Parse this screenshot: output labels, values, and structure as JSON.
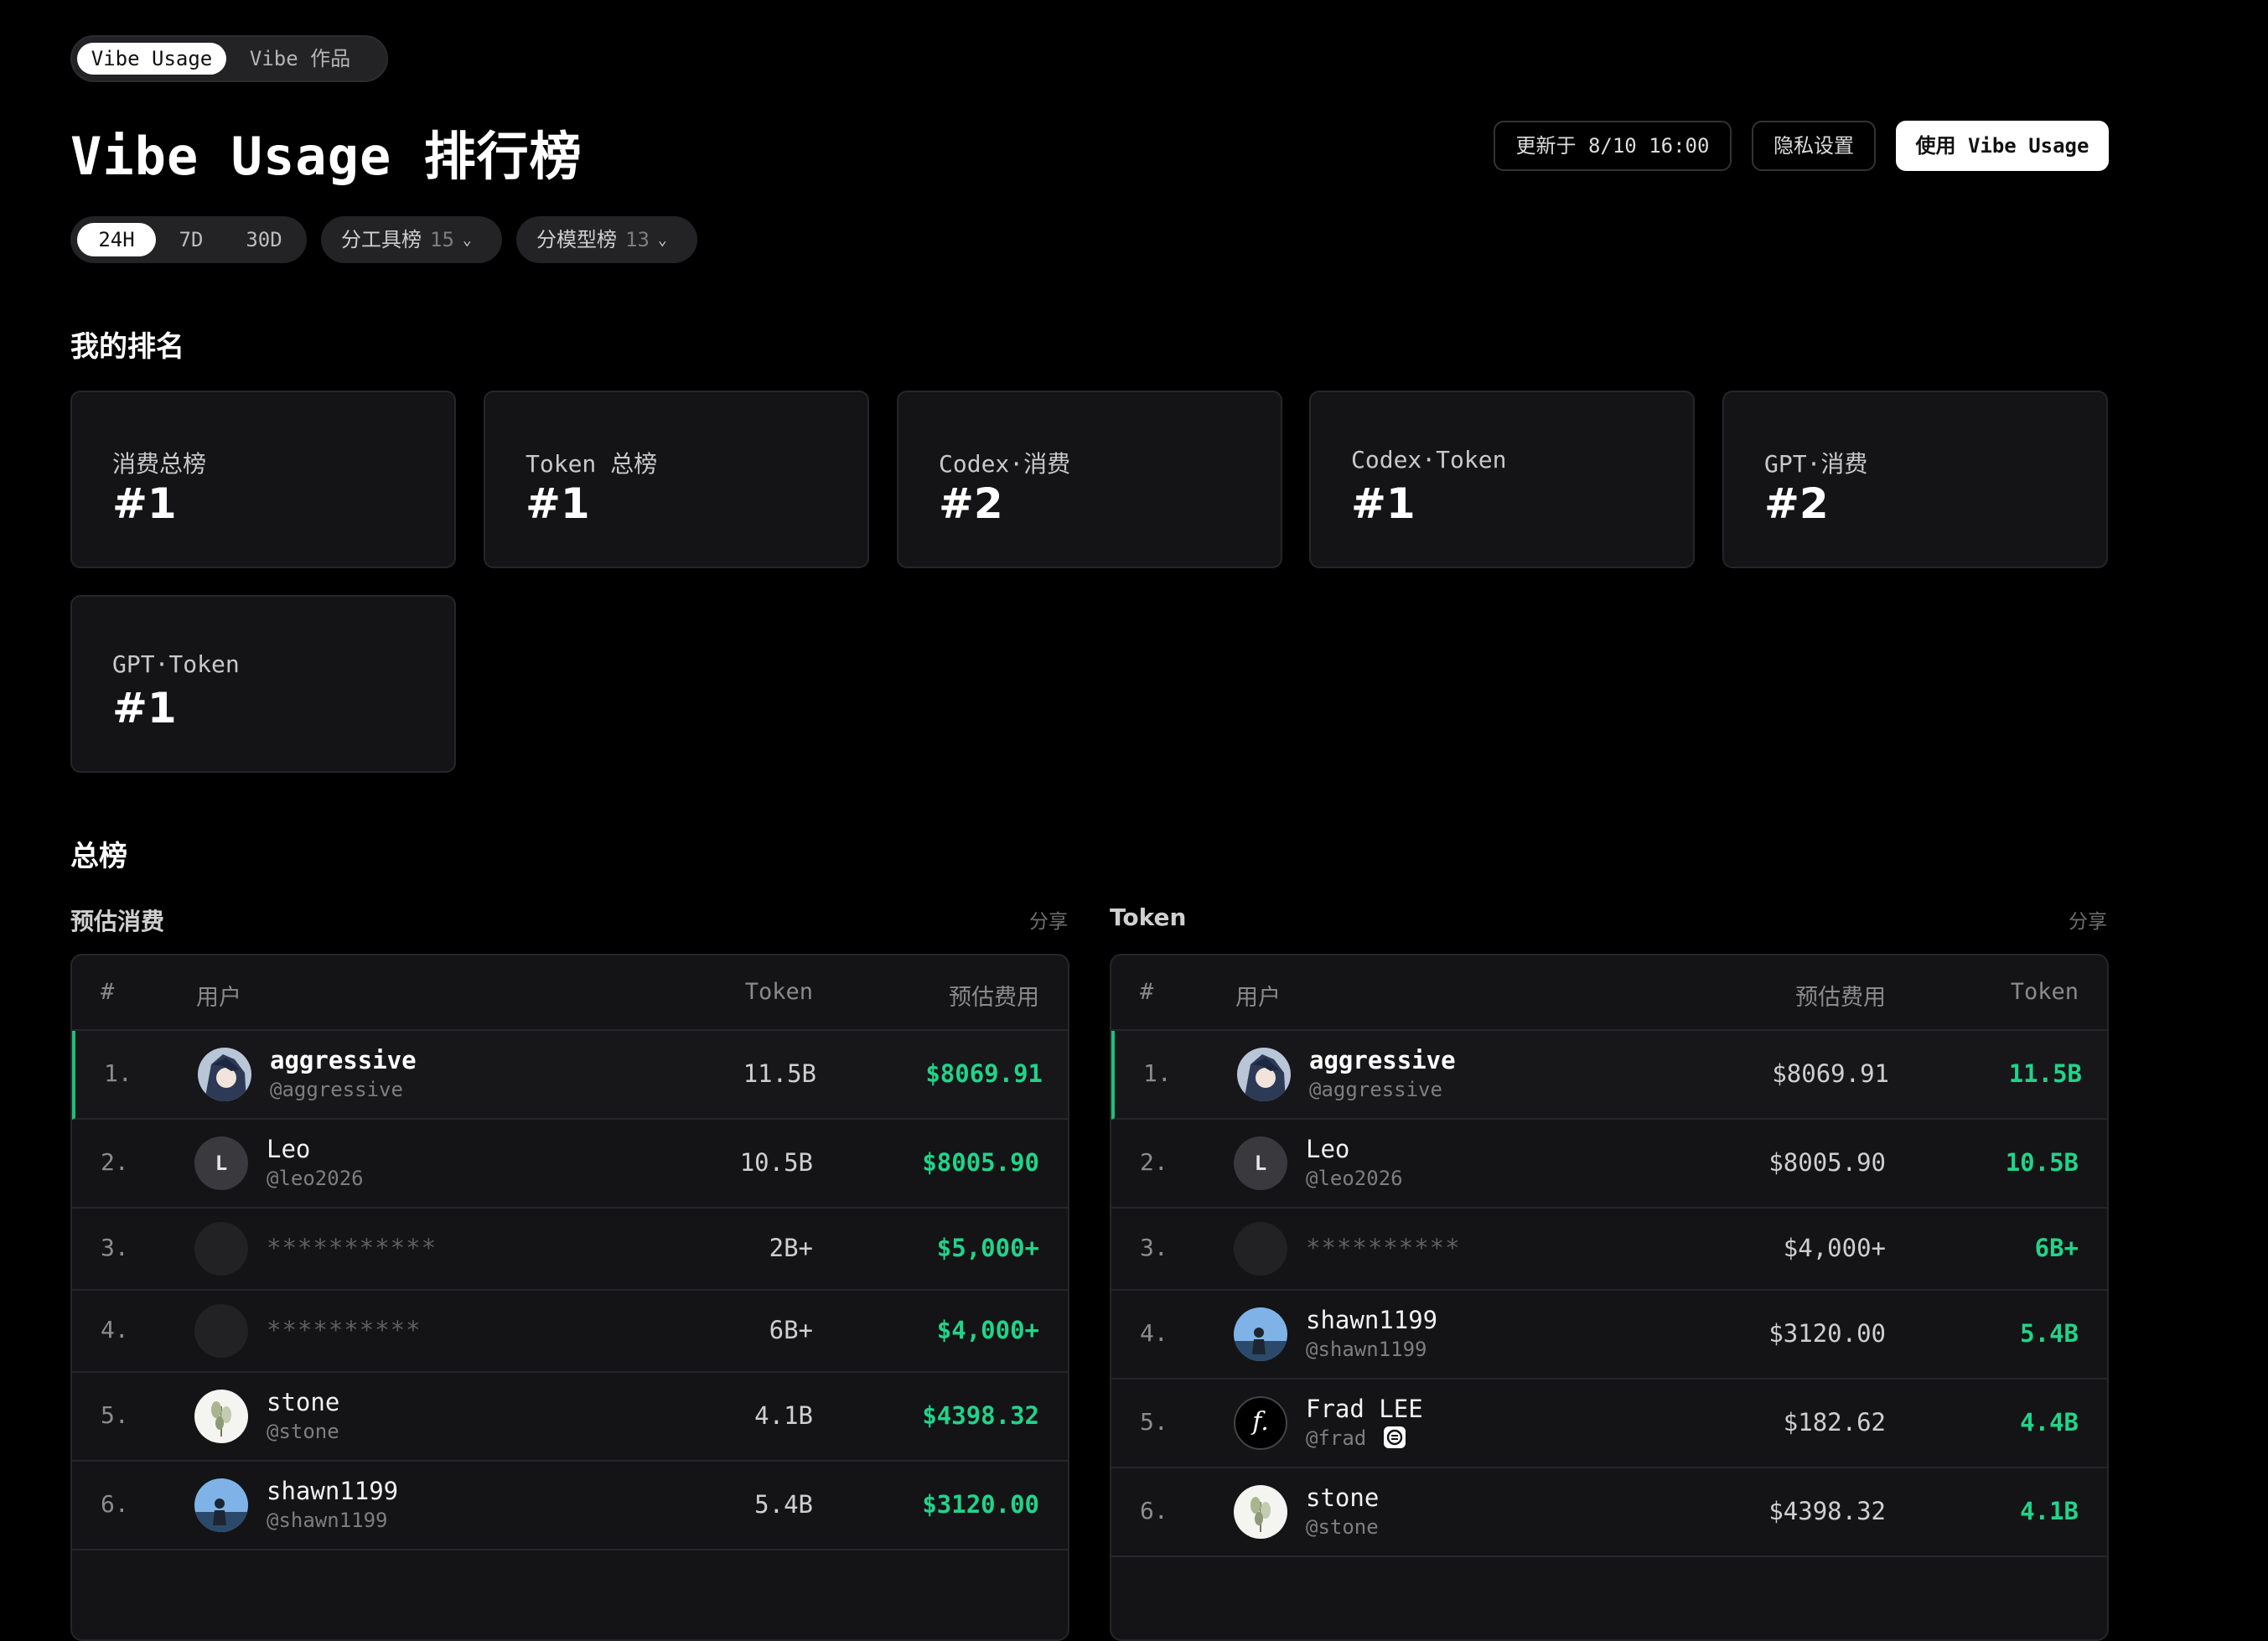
{
  "nav": {
    "toggle_active": "Vibe Usage",
    "toggle_inactive": "Vibe 作品"
  },
  "header": {
    "title": "Vibe Usage 排行榜",
    "updated": "更新于 8/10 16:00",
    "privacy": "隐私设置",
    "use_button": "使用 Vibe Usage"
  },
  "filters": {
    "ranges": [
      "24H",
      "7D",
      "30D"
    ],
    "active_range": "24H",
    "tool_board": {
      "label": "分工具榜",
      "count": "15"
    },
    "model_board": {
      "label": "分模型榜",
      "count": "13"
    }
  },
  "my_rank": {
    "title": "我的排名",
    "cards": [
      {
        "label": "消费总榜",
        "rank": "#1"
      },
      {
        "label": "Token 总榜",
        "rank": "#1"
      },
      {
        "label": "Codex·消费",
        "rank": "#2"
      },
      {
        "label": "Codex·Token",
        "rank": "#1"
      },
      {
        "label": "GPT·消费",
        "rank": "#2"
      },
      {
        "label": "GPT·Token",
        "rank": "#1"
      }
    ]
  },
  "overall": {
    "title": "总榜",
    "cost_board": {
      "title": "预估消费",
      "share": "分享",
      "columns": [
        "#",
        "用户",
        "Token",
        "预估费用"
      ],
      "rows": [
        {
          "rank": "1.",
          "name": "aggressive",
          "handle": "@aggressive",
          "token": "11.5B",
          "cost": "$8069.91"
        },
        {
          "rank": "2.",
          "name": "Leo",
          "handle": "@leo2026",
          "avatar_letter": "L",
          "token": "10.5B",
          "cost": "$8005.90"
        },
        {
          "rank": "3.",
          "masked": "***********",
          "token": "2B+",
          "cost": "$5,000+"
        },
        {
          "rank": "4.",
          "masked": "**********",
          "token": "6B+",
          "cost": "$4,000+"
        },
        {
          "rank": "5.",
          "name": "stone",
          "handle": "@stone",
          "token": "4.1B",
          "cost": "$4398.32"
        },
        {
          "rank": "6.",
          "name": "shawn1199",
          "handle": "@shawn1199",
          "token": "5.4B",
          "cost": "$3120.00"
        }
      ]
    },
    "token_board": {
      "title": "Token",
      "share": "分享",
      "columns": [
        "#",
        "用户",
        "预估费用",
        "Token"
      ],
      "rows": [
        {
          "rank": "1.",
          "name": "aggressive",
          "handle": "@aggressive",
          "cost": "$8069.91",
          "token": "11.5B"
        },
        {
          "rank": "2.",
          "name": "Leo",
          "handle": "@leo2026",
          "avatar_letter": "L",
          "cost": "$8005.90",
          "token": "10.5B"
        },
        {
          "rank": "3.",
          "masked": "**********",
          "cost": "$4,000+",
          "token": "6B+"
        },
        {
          "rank": "4.",
          "name": "shawn1199",
          "handle": "@shawn1199",
          "cost": "$3120.00",
          "token": "5.4B"
        },
        {
          "rank": "5.",
          "name": "Frad LEE",
          "handle": "@frad",
          "avatar_letter": "f.",
          "cost": "$182.62",
          "token": "4.4B"
        },
        {
          "rank": "6.",
          "name": "stone",
          "handle": "@stone",
          "cost": "$4398.32",
          "token": "4.1B"
        }
      ]
    }
  },
  "colors": {
    "accent_green": "#22d38a",
    "background": "#000000",
    "card": "#141416"
  }
}
